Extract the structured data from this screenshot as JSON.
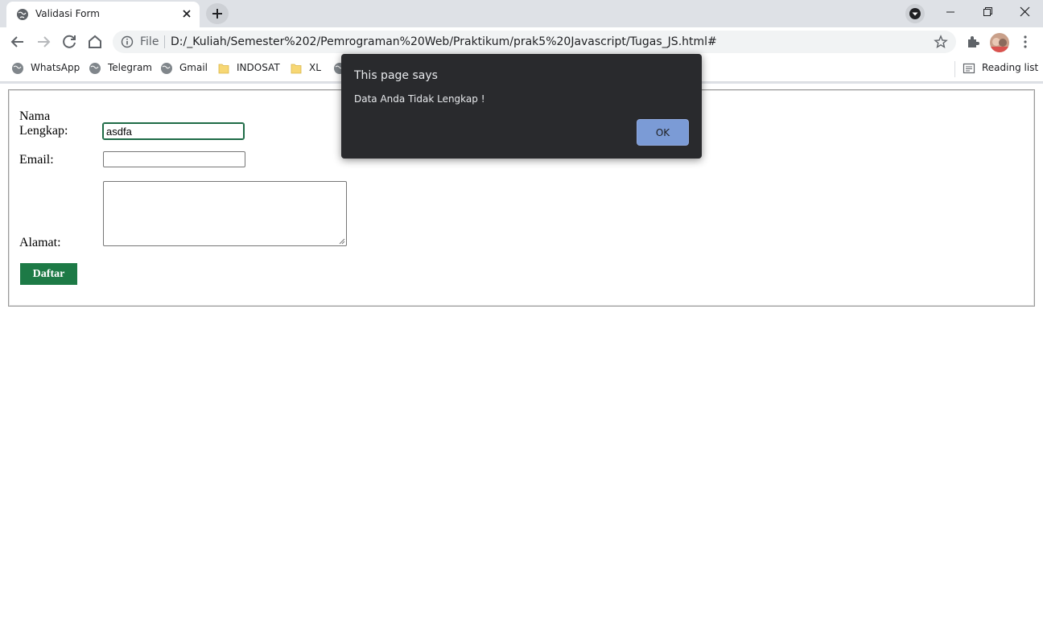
{
  "browser": {
    "tab": {
      "title": "Validasi Form"
    },
    "address": {
      "scheme_label": "File",
      "url": "D:/_Kuliah/Semester%202/Pemrograman%20Web/Praktikum/prak5%20Javascript/Tugas_JS.html#"
    },
    "bookmarks": [
      {
        "label": "WhatsApp",
        "icon": "globe-icon"
      },
      {
        "label": "Telegram",
        "icon": "globe-icon"
      },
      {
        "label": "Gmail",
        "icon": "globe-icon"
      },
      {
        "label": "INDOSAT",
        "icon": "folder-icon"
      },
      {
        "label": "XL",
        "icon": "folder-icon"
      }
    ],
    "reading_list_label": "Reading list"
  },
  "form": {
    "nama_label_line1": "Nama",
    "nama_label_line2": "Lengkap:",
    "nama_value": "asdfa",
    "email_label": "Email:",
    "email_value": "",
    "alamat_label": "Alamat:",
    "alamat_value": "",
    "submit_label": "Daftar",
    "submit_color": "#1d7a46"
  },
  "dialog": {
    "title": "This page says",
    "message": "Data Anda Tidak Lengkap !",
    "ok_label": "OK"
  }
}
